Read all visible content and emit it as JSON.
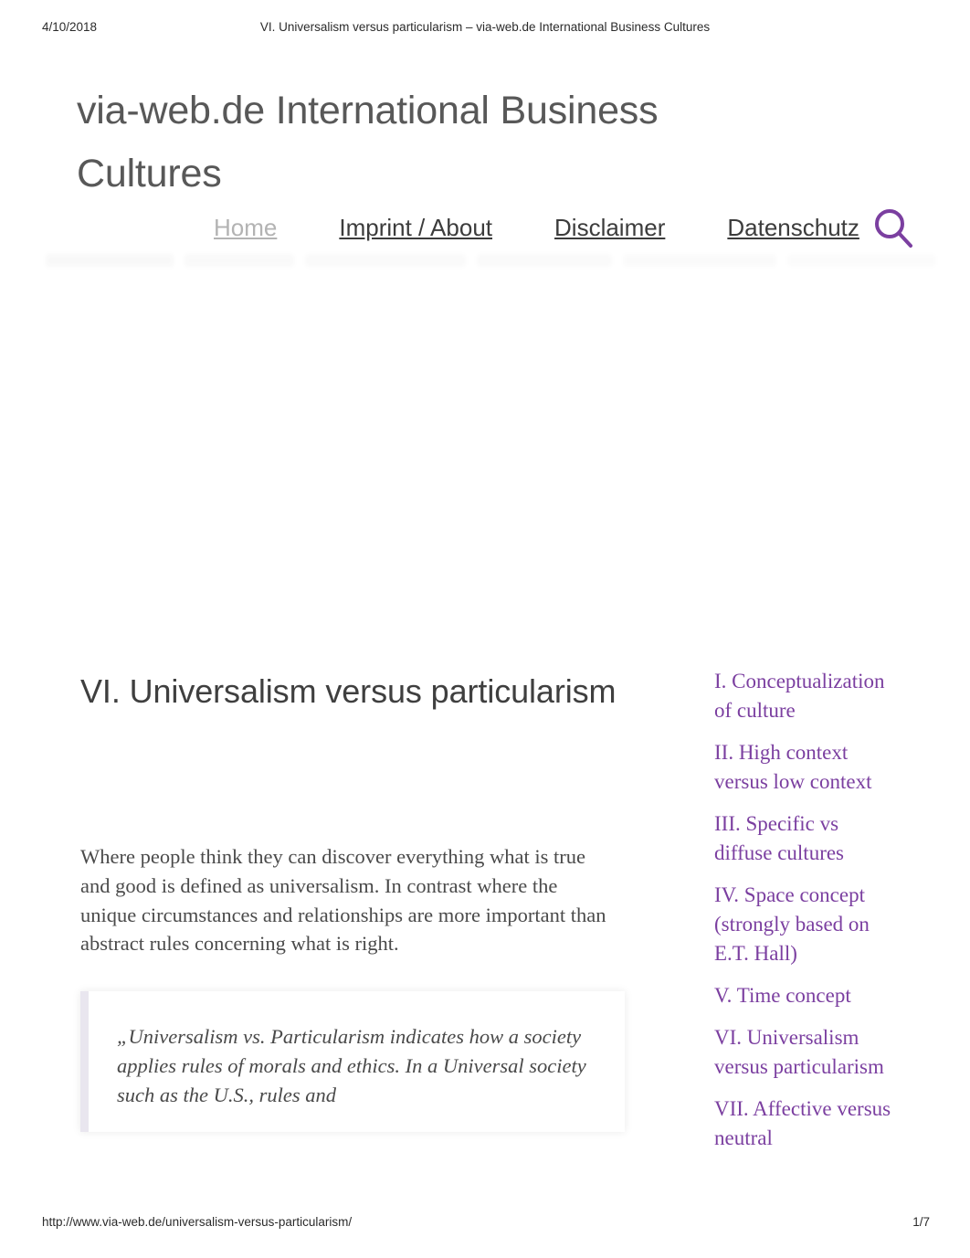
{
  "print": {
    "date": "4/10/2018",
    "header_title": "VI. Universalism versus particularism – via-web.de International Business Cultures",
    "footer_url": "http://www.via-web.de/universalism-versus-particularism/",
    "page_number": "1/7"
  },
  "site": {
    "title": "via-web.de International Business Cultures",
    "accent_color": "#7b3fa0",
    "title_color": "#585858"
  },
  "nav": {
    "items": [
      {
        "label": "Home",
        "current": true
      },
      {
        "label": "Imprint / About",
        "current": false
      },
      {
        "label": "Disclaimer",
        "current": false
      },
      {
        "label": "Datenschutz",
        "current": false
      }
    ],
    "search_icon": "search-icon"
  },
  "article": {
    "title": "VI. Universalism versus particularism",
    "paragraph": "Where people think they can discover everything what is true and good is defined as universalism. In contrast where the unique circumstances and relationships are more important than abstract rules concerning what is right.",
    "blockquote": "„Universalism vs. Particularism indicates how a society applies rules of morals and ethics. In a Universal society such as the U.S., rules and"
  },
  "sidebar": {
    "links": [
      {
        "label": "I. Conceptualization of culture"
      },
      {
        "label": "II. High context versus low context"
      },
      {
        "label": "III. Specific vs diffuse cultures"
      },
      {
        "label": "IV. Space concept (strongly based on E.T. Hall)"
      },
      {
        "label": "V. Time concept"
      },
      {
        "label": "VI. Universalism versus particularism"
      },
      {
        "label": "VII. Affective versus neutral"
      }
    ]
  }
}
